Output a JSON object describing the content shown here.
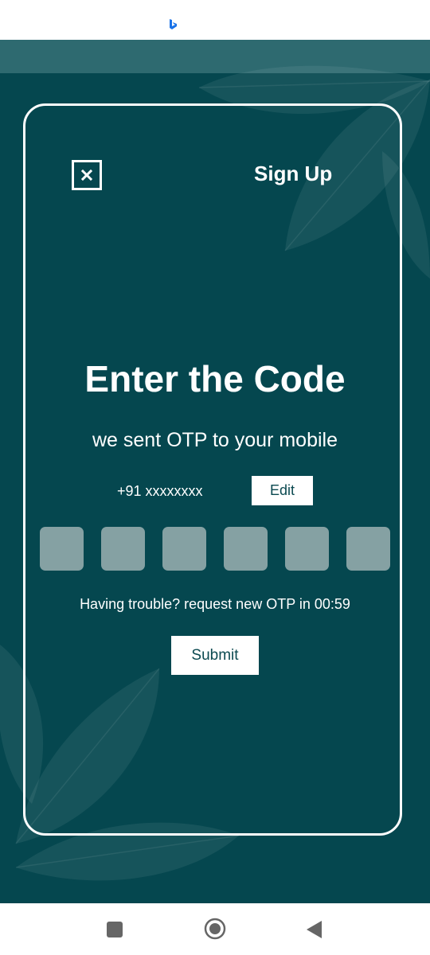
{
  "status_bar": {
    "icon": "bing-icon"
  },
  "header": {
    "close_icon": "close-icon",
    "signup_label": "Sign Up"
  },
  "main": {
    "title": "Enter the Code",
    "subtitle": "we sent OTP to your mobile",
    "phone_number": "+91 xxxxxxxx",
    "edit_label": "Edit",
    "otp_slots": [
      "",
      "",
      "",
      "",
      "",
      ""
    ],
    "resend_text": "Having trouble? request new OTP in 00:59",
    "submit_label": "Submit"
  },
  "navigation_bar": {
    "recents_icon": "recents-icon",
    "home_icon": "home-icon",
    "back_icon": "back-icon"
  },
  "colors": {
    "background": "#05474f",
    "otp_box": "#85a1a3",
    "button_text": "#0b4950",
    "card_border": "#ffffff"
  }
}
